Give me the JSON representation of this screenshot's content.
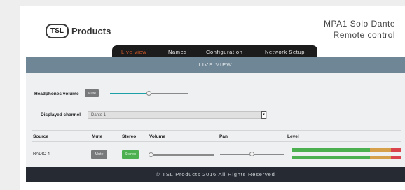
{
  "header": {
    "logo_mark": "TSL",
    "logo_text": "Products",
    "product_line1": "MPA1 Solo Dante",
    "product_line2": "Remote control"
  },
  "tabs": [
    {
      "label": "Live view",
      "active": true
    },
    {
      "label": "Names",
      "active": false
    },
    {
      "label": "Configuration",
      "active": false
    },
    {
      "label": "Network Setup",
      "active": false
    }
  ],
  "panel": {
    "title": "LIVE VIEW",
    "headphones_volume_label": "Headphones volume",
    "headphones_mute_label": "Mute",
    "displayed_channel_label": "Displayed channel",
    "displayed_channel_value": "Dante 1"
  },
  "table": {
    "columns": [
      "Source",
      "Mute",
      "Stereo",
      "Volume",
      "Pan",
      "Level"
    ],
    "rows": [
      {
        "source": "RADIO 4",
        "mute_label": "Mute",
        "stereo_label": "Stereo"
      }
    ]
  },
  "footer": {
    "text": "© TSL Products 2016 All Rights Reserved"
  },
  "colors": {
    "active_tab": "#d35a2a",
    "panel_header": "#6f8696",
    "slider_accent": "#1aa0a6",
    "stereo_on": "#4caf50",
    "meter_green": "#4caf50",
    "meter_amber": "#d6a04a",
    "meter_red": "#d9424a"
  }
}
